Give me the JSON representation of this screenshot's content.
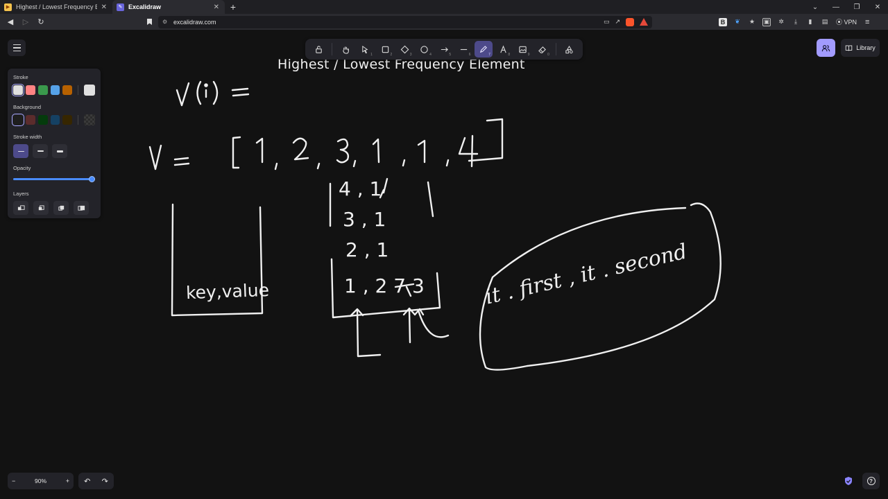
{
  "browser": {
    "tabs": [
      {
        "title": "Highest / Lowest Frequency Eleme",
        "active": false
      },
      {
        "title": "Excalidraw",
        "active": true
      }
    ],
    "url": "excalidraw.com",
    "vpn_label": "VPN"
  },
  "app": {
    "library_label": "Library",
    "toolbar_shortcuts": [
      "",
      "",
      "1",
      "2",
      "3",
      "4",
      "5",
      "6",
      "7",
      "8",
      "9",
      "0",
      ""
    ]
  },
  "properties": {
    "stroke_label": "Stroke",
    "background_label": "Background",
    "stroke_width_label": "Stroke width",
    "opacity_label": "Opacity",
    "opacity_value": 1.0,
    "layers_label": "Layers",
    "stroke_colors": [
      "#e0e0e0",
      "#ff8383",
      "#3a994c",
      "#56a2e8",
      "#b76100"
    ],
    "stroke_current": "#e0e0e0",
    "background_colors": [
      "#1e1e1e",
      "#5b2c2c",
      "#043b0c",
      "#154163",
      "#362600"
    ]
  },
  "drawing": {
    "title": "Highest / Lowest Frequency Element",
    "vector_expr": "v(i) =",
    "array_expr": "V = [ 1 , 2 , 3 , 1 , 1 , 4 ]",
    "box_label": "key,value",
    "map_entries": [
      "4 , 1",
      "3 , 1",
      "2 , 1",
      "1 , 2 7 3"
    ],
    "iterator_text": "it . first , it . second"
  },
  "footer": {
    "zoom": "90%",
    "zoom_out": "−",
    "zoom_in": "+"
  }
}
